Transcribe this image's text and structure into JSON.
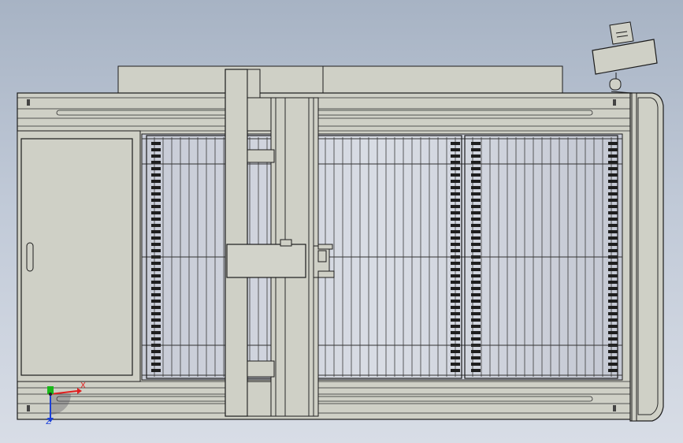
{
  "view": {
    "background_top": "#a7b3c4",
    "background_bottom": "#d8dde6",
    "machine_fill": "#cfd0c6",
    "outline": "#1c1c1c"
  },
  "triad": {
    "x_label": "X",
    "z_label": "Z",
    "x_color": "#e02020",
    "y_color": "#18b818",
    "z_color": "#1a3fd8"
  }
}
